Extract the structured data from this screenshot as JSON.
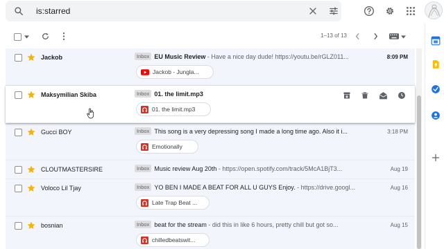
{
  "search": {
    "query": "is:starred"
  },
  "toolbar": {
    "page_count": "1–13 of 13"
  },
  "emails": [
    {
      "sender": "Jackob",
      "sender_bold": true,
      "badge": "Inbox",
      "subject": "EU Music Review",
      "subject_bold": true,
      "snippet": " - Have a nice day dude! https://youtu.be/rGLZ011...",
      "date": "8:09 PM",
      "date_bold": true,
      "attachment": "Jackob - Jungla...",
      "attachment_type": "youtube"
    },
    {
      "sender": "Maksymilian Skiba",
      "sender_bold": true,
      "badge": "Inbox",
      "subject": "01. the limit.mp3",
      "subject_bold": true,
      "snippet": "",
      "date": "",
      "attachment": "01. the limit.mp3",
      "attachment_type": "audio"
    },
    {
      "sender": "Gucci BOY",
      "badge": "Inbox",
      "subject": "This song is a very depressing song I made a long time ago. Also it i...",
      "snippet": "",
      "date": "3:18 PM",
      "attachment": "Emotionally",
      "attachment_type": "audio"
    },
    {
      "sender": "CLOUTMASTERSIRE",
      "badge": "Inbox",
      "subject": "Music review Aug 20th",
      "snippet": " - https://open.spotify.com/track/5McA1BjT3...",
      "date": "Aug 19",
      "attachment": ""
    },
    {
      "sender": "Voloco Lil Tjay",
      "badge": "Inbox",
      "subject": "YO BEN I MADE A BEAT FOR ALL U GUYS Enjoy.",
      "snippet": " - https://drive.googl...",
      "date": "Aug 16",
      "attachment": "Late Trap Beat ...",
      "attachment_type": "audio"
    },
    {
      "sender": "bosnian",
      "badge": "Inbox",
      "subject": "beat for the stream",
      "snippet": " - did this in like 6 hours, pretty chill but got so...",
      "date": "Aug 15",
      "attachment": "chilledbeatswit...",
      "attachment_type": "audio"
    }
  ],
  "colors": {
    "star": "#f4b400",
    "youtube_red": "#ff0000",
    "audio_red": "#d93025",
    "row_read_bg": "#f2f6fc",
    "badge_bg": "#dddddd"
  },
  "icons": {
    "search": "search-icon",
    "clear": "close-icon",
    "filter": "tune-icon",
    "help": "help-icon",
    "settings": "gear-icon",
    "apps": "apps-grid-icon",
    "refresh": "refresh-icon",
    "more": "more-vert-icon"
  }
}
